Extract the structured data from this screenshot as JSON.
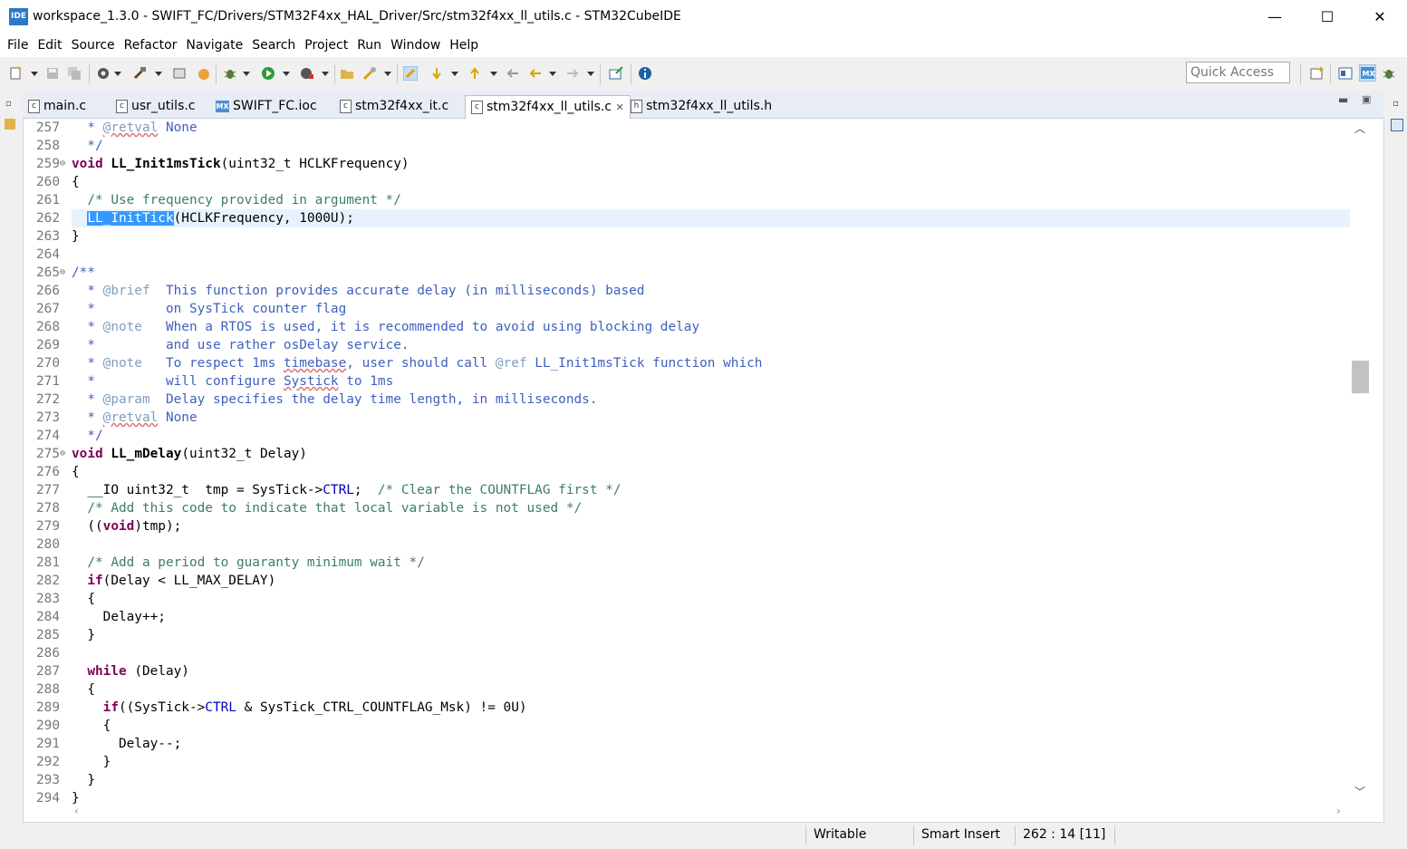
{
  "window": {
    "logo": "IDE",
    "title": "workspace_1.3.0 - SWIFT_FC/Drivers/STM32F4xx_HAL_Driver/Src/stm32f4xx_ll_utils.c - STM32CubeIDE",
    "minimize": "—",
    "maximize": "☐",
    "close": "✕"
  },
  "menu": [
    "File",
    "Edit",
    "Source",
    "Refactor",
    "Navigate",
    "Search",
    "Project",
    "Run",
    "Window",
    "Help"
  ],
  "toolbar": {
    "quick_access_placeholder": "Quick Access",
    "icons": [
      "new-icon",
      "save-icon",
      "save-all-icon",
      "settings-icon",
      "build-icon",
      "debug-config-icon",
      "bug-icon",
      "run-icon",
      "external-tools-icon",
      "open-type-icon",
      "search-icon",
      "highlight-icon",
      "next-annotation-icon",
      "prev-annotation-icon",
      "back-icon",
      "forward-icon",
      "pin-icon",
      "info-icon"
    ]
  },
  "tabs": [
    {
      "label": "main.c",
      "icon": "c"
    },
    {
      "label": "usr_utils.c",
      "icon": "c"
    },
    {
      "label": "SWIFT_FC.ioc",
      "icon": "MX"
    },
    {
      "label": "stm32f4xx_it.c",
      "icon": "c"
    },
    {
      "label": "stm32f4xx_ll_utils.c",
      "icon": "c",
      "active": true,
      "close": "✕"
    },
    {
      "label": "stm32f4xx_ll_utils.h",
      "icon": "h"
    }
  ],
  "editor": {
    "line_numbers": [
      "257",
      "258",
      "259",
      "260",
      "261",
      "262",
      "263",
      "264",
      "265",
      "266",
      "267",
      "268",
      "269",
      "270",
      "271",
      "272",
      "273",
      "274",
      "275",
      "276",
      "277",
      "278",
      "279",
      "280",
      "281",
      "282",
      "283",
      "284",
      "285",
      "286",
      "287",
      "288",
      "289",
      "290",
      "291",
      "292",
      "293",
      "294"
    ],
    "code_lines": [
      "  * @retval None",
      "  */",
      "void LL_Init1msTick(uint32_t HCLKFrequency)",
      "{",
      "  /* Use frequency provided in argument */",
      "  LL_InitTick(HCLKFrequency, 1000U);",
      "}",
      "",
      "/**",
      "  * @brief  This function provides accurate delay (in milliseconds) based",
      "  *         on SysTick counter flag",
      "  * @note   When a RTOS is used, it is recommended to avoid using blocking delay",
      "  *         and use rather osDelay service.",
      "  * @note   To respect 1ms timebase, user should call @ref LL_Init1msTick function which",
      "  *         will configure Systick to 1ms",
      "  * @param  Delay specifies the delay time length, in milliseconds.",
      "  * @retval None",
      "  */",
      "void LL_mDelay(uint32_t Delay)",
      "{",
      "  __IO uint32_t  tmp = SysTick->CTRL;  /* Clear the COUNTFLAG first */",
      "  /* Add this code to indicate that local variable is not used */",
      "  ((void)tmp);",
      "",
      "  /* Add a period to guaranty minimum wait */",
      "  if(Delay < LL_MAX_DELAY)",
      "  {",
      "    Delay++;",
      "  }",
      "",
      "  while (Delay)",
      "  {",
      "    if((SysTick->CTRL & SysTick_CTRL_COUNTFLAG_Msk) != 0U)",
      "    {",
      "      Delay--;",
      "    }",
      "  }",
      "}"
    ],
    "selected_text": "LL_InitTick"
  },
  "status": {
    "writable": "Writable",
    "insert_mode": "Smart Insert",
    "position": "262 : 14 [11]"
  }
}
